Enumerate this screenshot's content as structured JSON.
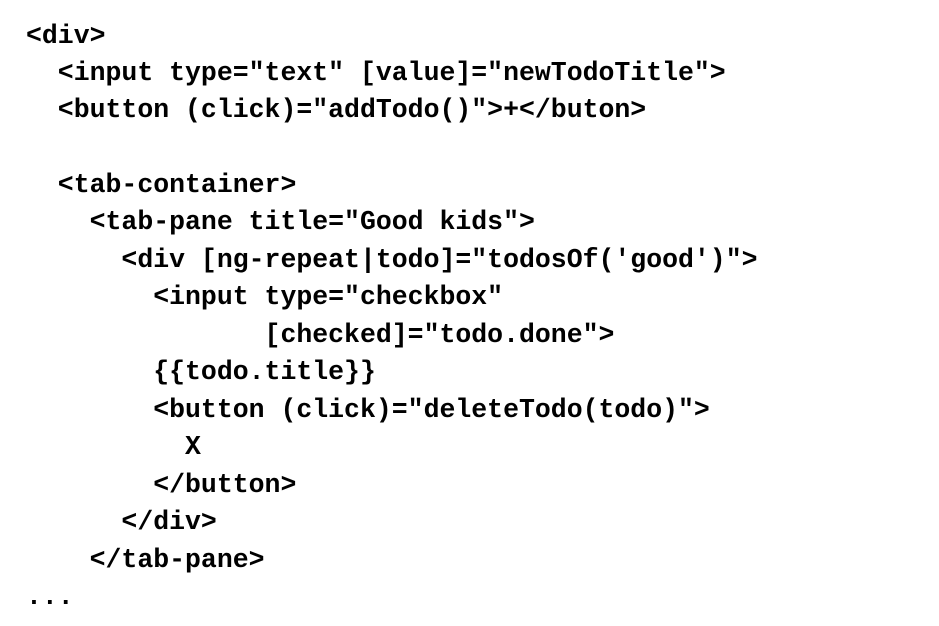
{
  "code": {
    "lines": [
      "<div>",
      "  <input type=\"text\" [value]=\"newTodoTitle\">",
      "  <button (click)=\"addTodo()\">+</buton>",
      "",
      "  <tab-container>",
      "    <tab-pane title=\"Good kids\">",
      "      <div [ng-repeat|todo]=\"todosOf('good')\">",
      "        <input type=\"checkbox\"",
      "               [checked]=\"todo.done\">",
      "        {{todo.title}}",
      "        <button (click)=\"deleteTodo(todo)\">",
      "          X",
      "        </button>",
      "      </div>",
      "    </tab-pane>",
      "..."
    ]
  }
}
